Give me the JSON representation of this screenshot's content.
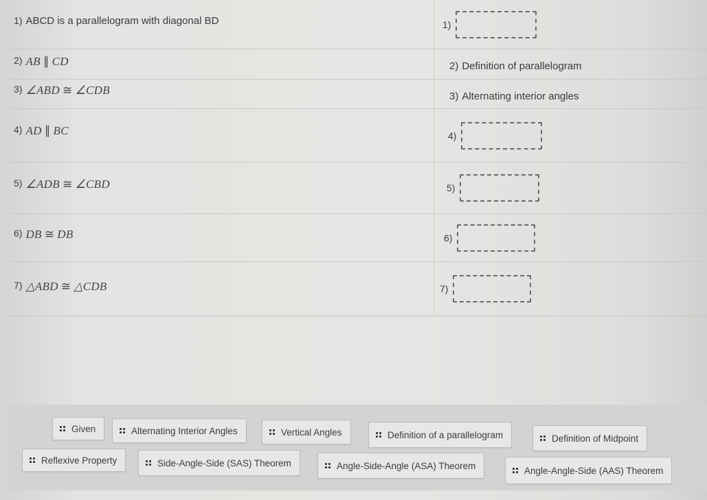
{
  "proof": {
    "rows": [
      {
        "number": "1)",
        "statement_kind": "text",
        "statement": "ABCD is a parallelogram with diagonal BD",
        "reason_number": "1)",
        "reason": "",
        "reason_filled": false
      },
      {
        "number": "2)",
        "statement_kind": "math",
        "statement_parts": [
          "AB",
          "∥",
          "CD"
        ],
        "reason_number": "2)",
        "reason": "Definition of parallelogram",
        "reason_filled": true
      },
      {
        "number": "3)",
        "statement_kind": "math",
        "statement_parts": [
          "∠ABD",
          "≅",
          "∠CDB"
        ],
        "reason_number": "3)",
        "reason": "Alternating interior angles",
        "reason_filled": true
      },
      {
        "number": "4)",
        "statement_kind": "math",
        "statement_parts": [
          "AD",
          "∥",
          "BC"
        ],
        "reason_number": "4)",
        "reason": "",
        "reason_filled": false
      },
      {
        "number": "5)",
        "statement_kind": "math",
        "statement_parts": [
          "∠ADB",
          "≅",
          "∠CBD"
        ],
        "reason_number": "5)",
        "reason": "",
        "reason_filled": false
      },
      {
        "number": "6)",
        "statement_kind": "math",
        "statement_parts": [
          "DB",
          "≅",
          "DB"
        ],
        "reason_number": "6)",
        "reason": "",
        "reason_filled": false
      },
      {
        "number": "7)",
        "statement_kind": "math",
        "statement_parts": [
          "△ABD",
          "≅",
          "△CDB"
        ],
        "reason_number": "7)",
        "reason": "",
        "reason_filled": false
      }
    ]
  },
  "answer_bank": {
    "drag_handle_icon": "grip-dots-icon",
    "chips": [
      {
        "label": "Given"
      },
      {
        "label": "Alternating Interior Angles"
      },
      {
        "label": "Vertical Angles"
      },
      {
        "label": "Definition of a parallelogram"
      },
      {
        "label": "Definition of Midpoint"
      },
      {
        "label": "Reflexive Property"
      },
      {
        "label": "Side-Angle-Side (SAS) Theorem"
      },
      {
        "label": "Angle-Side-Angle (ASA) Theorem"
      },
      {
        "label": "Angle-Angle-Side (AAS) Theorem"
      }
    ]
  }
}
